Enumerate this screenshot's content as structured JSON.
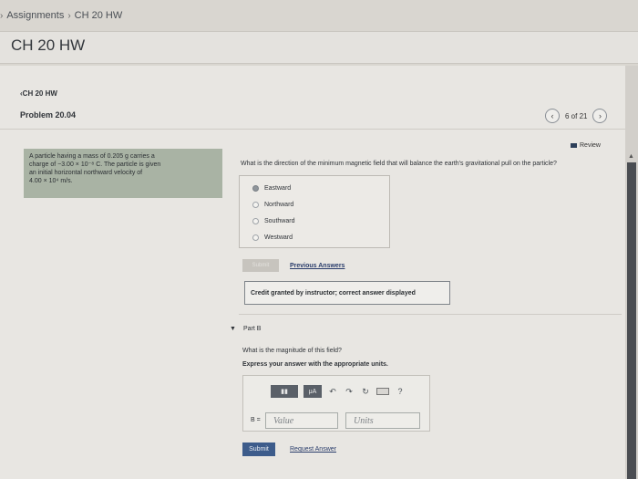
{
  "breadcrumb": {
    "items": [
      "Assignments",
      "CH 20 HW"
    ]
  },
  "header": {
    "title": "CH 20 HW"
  },
  "nav": {
    "back_label": "CH 20 HW",
    "problem_title": "Problem 20.04",
    "pager_text": "6 of 21"
  },
  "review": {
    "label": "Review"
  },
  "problem": {
    "line1": "A particle having a mass of 0.205 g carries a",
    "line2": "charge of −3.00 × 10⁻⁸ C. The particle is given",
    "line3": "an initial horizontal northward velocity of",
    "line4": "4.00 × 10⁴ m/s."
  },
  "partA": {
    "question": "What is the direction of the minimum magnetic field that will balance the earth's gravitational pull on the particle?",
    "choices": [
      "Eastward",
      "Northward",
      "Southward",
      "Westward"
    ],
    "selected_index": 0,
    "submit_label": "Submit",
    "previous_answers_label": "Previous Answers",
    "credit_text": "Credit granted by instructor; correct answer displayed"
  },
  "partB": {
    "label": "Part B",
    "question": "What is the magnitude of this field?",
    "instruction": "Express your answer with the appropriate units.",
    "variable": "B =",
    "value_placeholder": "Value",
    "units_placeholder": "Units",
    "toolbar": {
      "template_label": "▮▮",
      "mu_label": "μA",
      "help_label": "?"
    },
    "submit_label": "Submit",
    "request_label": "Request Answer"
  }
}
